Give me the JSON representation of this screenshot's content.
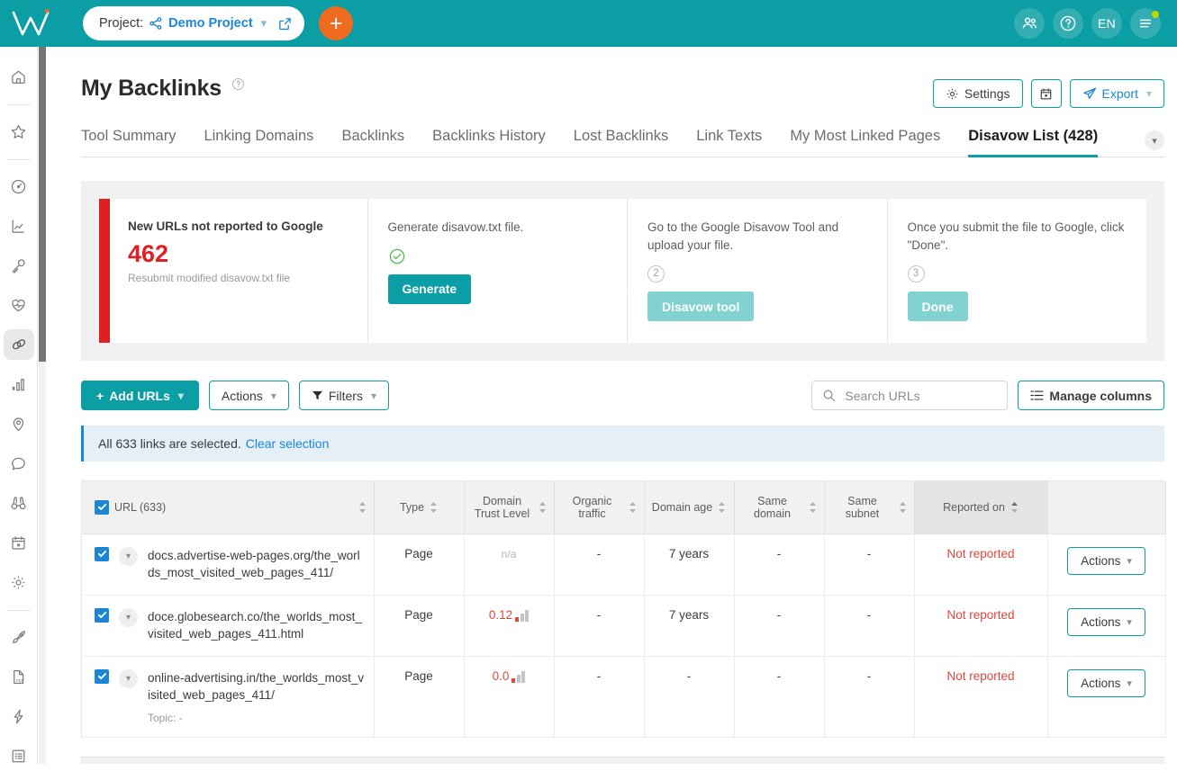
{
  "topbar": {
    "logo": "wincher-logo",
    "project_label": "Project:",
    "project_name": "Demo Project",
    "add_button": "+",
    "icons": {
      "share": "share-nodes-icon",
      "chevron": "chevron-down-icon",
      "external": "external-link-icon",
      "users": "users-icon",
      "help": "help-circle-icon",
      "menu": "hamburger-menu-icon"
    },
    "lang": "EN"
  },
  "sidebar": {
    "items": [
      {
        "name": "home",
        "icon": "home-icon"
      },
      {
        "name": "favorites",
        "icon": "star-icon"
      },
      {
        "name": "dashboard",
        "icon": "gauge-icon"
      },
      {
        "name": "rank-tracking",
        "icon": "line-chart-icon"
      },
      {
        "name": "keywords",
        "icon": "key-icon"
      },
      {
        "name": "site-health",
        "icon": "heart-pulse-icon"
      },
      {
        "name": "backlinks",
        "icon": "link-chain-icon",
        "active": true
      },
      {
        "name": "analytics",
        "icon": "bar-chart-icon"
      },
      {
        "name": "local-seo",
        "icon": "map-pin-icon"
      },
      {
        "name": "messages",
        "icon": "chat-bubble-icon"
      },
      {
        "name": "competitors",
        "icon": "binoculars-icon"
      },
      {
        "name": "calendar",
        "icon": "calendar-icon"
      },
      {
        "name": "settings",
        "icon": "gear-icon"
      },
      {
        "name": "boost",
        "icon": "rocket-icon"
      },
      {
        "name": "pdf-reports",
        "icon": "pdf-file-icon"
      },
      {
        "name": "automation",
        "icon": "lightning-bolt-icon"
      },
      {
        "name": "tasks",
        "icon": "list-checklist-icon"
      }
    ]
  },
  "page": {
    "title": "My Backlinks",
    "help_icon": "question-circle-icon",
    "actions": {
      "settings": "Settings",
      "settings_icon": "gear-icon",
      "calendar_icon": "calendar-icon",
      "export": "Export",
      "export_icon": "paper-plane-icon"
    }
  },
  "tabs": [
    {
      "label": "Tool Summary",
      "active": false
    },
    {
      "label": "Linking Domains",
      "active": false
    },
    {
      "label": "Backlinks",
      "active": false
    },
    {
      "label": "Backlinks History",
      "active": false
    },
    {
      "label": "Lost Backlinks",
      "active": false
    },
    {
      "label": "Link Texts",
      "active": false
    },
    {
      "label": "My Most Linked Pages",
      "active": false
    },
    {
      "label": "Disavow List (428)",
      "active": true
    }
  ],
  "steps": [
    {
      "title": "New URLs not reported to Google",
      "value": "462",
      "sub": "Resubmit modified disavow.txt file"
    },
    {
      "text": "Generate disavow.txt file.",
      "marker": "check",
      "button": "Generate",
      "button_state": "enabled"
    },
    {
      "text": "Go to the Google Disavow Tool and upload your file.",
      "marker": "2",
      "button": "Disavow tool",
      "button_state": "muted"
    },
    {
      "text": "Once you submit the file to Google, click \"Done\".",
      "marker": "3",
      "button": "Done",
      "button_state": "muted"
    }
  ],
  "toolbar": {
    "add_urls": "Add URLs",
    "actions": "Actions",
    "filters": "Filters",
    "filters_icon": "funnel-icon",
    "search_placeholder": "Search URLs",
    "search_value": "",
    "search_icon": "search-icon",
    "manage_columns": "Manage columns",
    "manage_columns_icon": "columns-icon"
  },
  "selection_banner": {
    "text": "All 633 links are selected.",
    "link": "Clear selection"
  },
  "table": {
    "headers": [
      {
        "label": "URL (633)",
        "sorted": false
      },
      {
        "label": "Type",
        "sorted": false
      },
      {
        "label": "Domain Trust Level",
        "sorted": false
      },
      {
        "label": "Organic traffic",
        "sorted": false
      },
      {
        "label": "Domain age",
        "sorted": false
      },
      {
        "label": "Same domain",
        "sorted": false
      },
      {
        "label": "Same subnet",
        "sorted": false
      },
      {
        "label": "Reported on",
        "sorted": true
      }
    ],
    "rows": [
      {
        "checked": true,
        "url": "docs.advertise-web-pages.org/the_worlds_most_visited_web_pages_411/",
        "topic": "",
        "type": "Page",
        "dtl": "n/a",
        "dtl_kind": "na",
        "organic_traffic": "-",
        "domain_age": "7 years",
        "same_domain": "-",
        "same_subnet": "-",
        "reported_on": "Not reported",
        "action": "Actions"
      },
      {
        "checked": true,
        "url": "doce.globesearch.co/the_worlds_most_visited_web_pages_411.html",
        "topic": "",
        "type": "Page",
        "dtl": "0.12",
        "dtl_kind": "value",
        "organic_traffic": "-",
        "domain_age": "7 years",
        "same_domain": "-",
        "same_subnet": "-",
        "reported_on": "Not reported",
        "action": "Actions"
      },
      {
        "checked": true,
        "url": "online-advertising.in/the_worlds_most_visited_web_pages_411/",
        "topic": "Topic: -",
        "type": "Page",
        "dtl": "0.0",
        "dtl_kind": "value",
        "organic_traffic": "-",
        "domain_age": "-",
        "same_domain": "-",
        "same_subnet": "-",
        "reported_on": "Not reported",
        "action": "Actions"
      }
    ]
  },
  "colors": {
    "brand_teal": "#0b9fa5",
    "accent_orange": "#ee6b1f",
    "link_blue": "#1b86d4",
    "alert_red": "#e02020",
    "status_red": "#e0473e",
    "banner_blue": "#e4eff7"
  }
}
